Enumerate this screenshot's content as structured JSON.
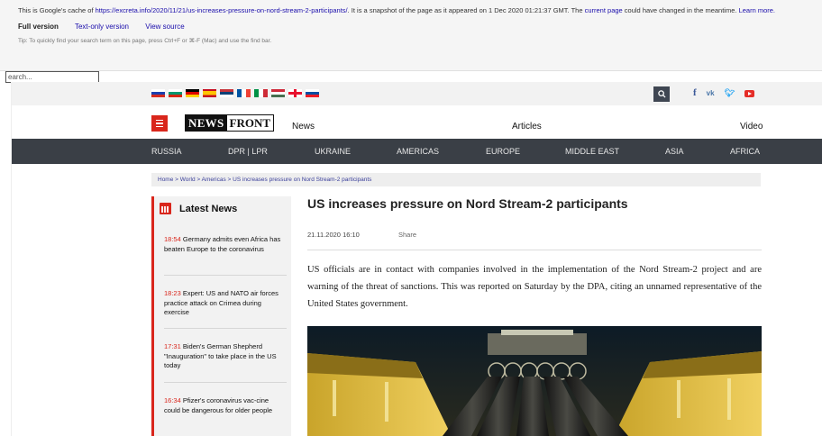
{
  "cache_banner": {
    "prefix": "This is Google's cache of ",
    "url": "https://excreta.info/2020/11/21/us-increases-pressure-on-nord-stream-2-participants/",
    "suffix": ". It is a snapshot of the page as it appeared on 1 Dec 2020 01:21:37 GMT. The ",
    "current_page_link": "current page",
    "suffix2": " could have changed in the meantime. ",
    "learn_more": "Learn more.",
    "full_version": "Full version",
    "text_only": "Text-only version",
    "view_source": "View source",
    "tip": "Tip: To quickly find your search term on this page, press Ctrl+F or ⌘-F (Mac) and use the find bar."
  },
  "search": {
    "placeholder": "earch..."
  },
  "flags": [
    "ru",
    "bg",
    "de",
    "es",
    "rs",
    "fr",
    "it",
    "hu",
    "ge",
    "sk"
  ],
  "socials": [
    "facebook-icon",
    "vk-icon",
    "twitter-icon",
    "youtube-icon"
  ],
  "logo": {
    "part1": "NEWS",
    "part2": "FRONT"
  },
  "top_nav": [
    "News",
    "Articles",
    "Video"
  ],
  "main_nav": [
    "RUSSIA",
    "DPR | LPR",
    "UKRAINE",
    "AMERICAS",
    "EUROPE",
    "MIDDLE EAST",
    "ASIA",
    "AFRICA"
  ],
  "breadcrumb": "Home > World > Americas > US increases pressure on Nord Stream-2 participants",
  "sidebar": {
    "title": "Latest News",
    "items": [
      {
        "time": "18:54",
        "text": "Germany admits even Africa has beaten Europe to the coronavirus"
      },
      {
        "time": "18:23",
        "text": "Expert: US and NATO air forces practice attack on Crimea during exercise"
      },
      {
        "time": "17:31",
        "text": "Biden's German Shepherd \"Inauguration\" to take place in the US today"
      },
      {
        "time": "16:34",
        "text": "Pfizer's coronavirus vac-cine could be dangerous for older people"
      }
    ]
  },
  "article": {
    "title": "US increases pressure on Nord Stream-2 participants",
    "date": "21.11.2020 16:10",
    "share": "Share",
    "body": "US officials are in contact with companies involved in the implementation of the Nord Stream-2 project and are warning of the threat of sanctions. This was reported on Saturday by the DPA, citing an unnamed representative of the United States government."
  }
}
